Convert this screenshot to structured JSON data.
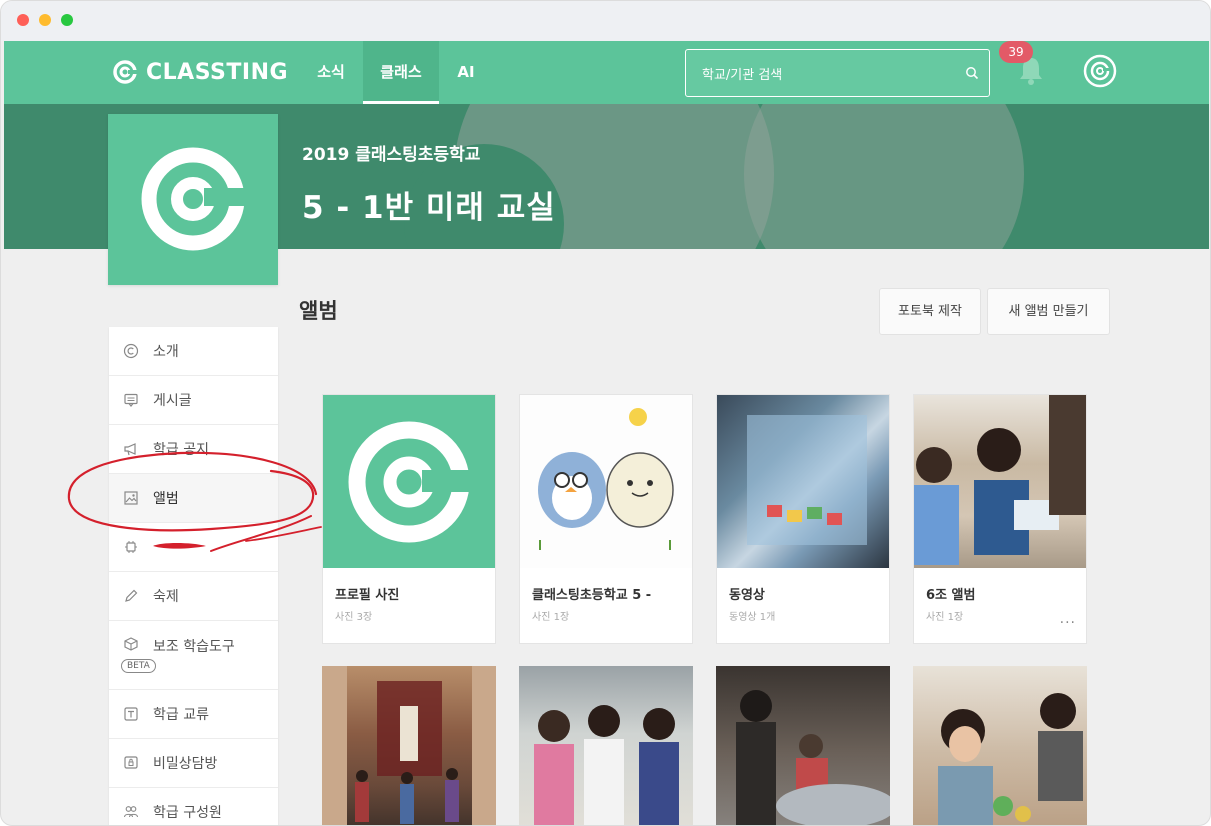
{
  "topnav": {
    "logo_text": "CLASSTING",
    "tabs": [
      {
        "label": "소식"
      },
      {
        "label": "클래스"
      },
      {
        "label": "AI"
      }
    ],
    "search_placeholder": "학교/기관 검색",
    "notification_count": "39"
  },
  "banner": {
    "school_name": "2019 클래스팅초등학교",
    "class_name": "5 - 1반 미래 교실"
  },
  "sidebar": {
    "items": [
      {
        "label": "소개",
        "icon": "copyright-icon"
      },
      {
        "label": "게시글",
        "icon": "post-icon"
      },
      {
        "label": "학급 공지",
        "icon": "megaphone-icon"
      },
      {
        "label": "앨범",
        "icon": "image-icon"
      },
      {
        "label": "",
        "icon": "chip-icon"
      },
      {
        "label": "숙제",
        "icon": "pencil-icon"
      },
      {
        "label": "보조 학습도구",
        "icon": "cube-icon",
        "badge": "BETA"
      },
      {
        "label": "학급 교류",
        "icon": "letter-t-icon"
      },
      {
        "label": "비밀상담방",
        "icon": "lock-chat-icon"
      },
      {
        "label": "학급 구성원",
        "icon": "members-icon"
      }
    ]
  },
  "main": {
    "title": "앨범",
    "buttons": {
      "photobook": "포토북 제작",
      "new_album": "새 앨범 만들기"
    },
    "albums": [
      {
        "title": "프로필 사진",
        "sub": "사진 3장"
      },
      {
        "title": "클래스팅초등학교 5 -",
        "sub": "사진 1장"
      },
      {
        "title": "동영상",
        "sub": "동영상 1개"
      },
      {
        "title": "6조 앨범",
        "sub": "사진 1장",
        "more": "..."
      }
    ]
  },
  "colors": {
    "brand_green": "#5cc49a",
    "banner_green": "#3f8a6c",
    "badge_red": "#e35a67",
    "annotation_red": "#d4202c"
  }
}
